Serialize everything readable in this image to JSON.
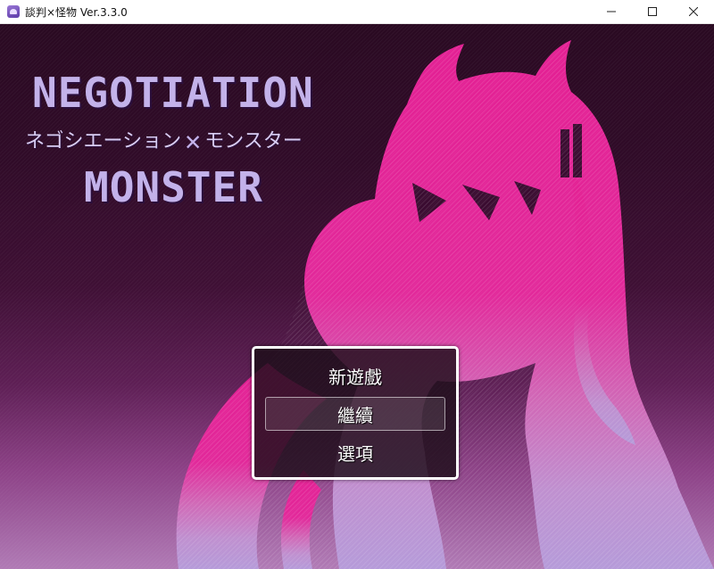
{
  "window": {
    "title": "談判×怪物 Ver.3.3.0",
    "icon": "app-monster-icon",
    "controls": [
      "minimize-icon",
      "maximize-icon",
      "close-icon"
    ]
  },
  "logo": {
    "line1": "NEGOTIATION",
    "line2_left": "ネゴシエーション",
    "line2_separator": "✕",
    "line2_right": "モンスター",
    "line3": "MONSTER"
  },
  "menu": {
    "items": [
      {
        "label": "新遊戲",
        "selected": false
      },
      {
        "label": "繼續",
        "selected": true
      },
      {
        "label": "選項",
        "selected": false
      }
    ]
  },
  "colors": {
    "background_top": "#2a0a22",
    "background_bottom": "#b07ab5",
    "silhouette_top": "#e31f93",
    "silhouette_bottom": "#b59ad9",
    "logo_text": "#c3b2ea",
    "menu_border": "#ffffff"
  }
}
